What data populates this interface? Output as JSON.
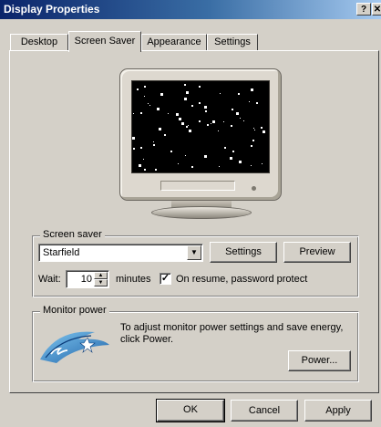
{
  "window": {
    "title": "Display Properties",
    "help_glyph": "?",
    "close_glyph": "✕"
  },
  "tabs": [
    {
      "label": "Desktop"
    },
    {
      "label": "Screen Saver"
    },
    {
      "label": "Appearance"
    },
    {
      "label": "Settings"
    }
  ],
  "screensaver": {
    "group_label": "Screen saver",
    "selected": "Starfield",
    "settings_label": "Settings",
    "preview_label": "Preview",
    "wait_label": "Wait:",
    "wait_value": "10",
    "minutes_label": "minutes",
    "checkbox_checked": true,
    "checkbox_label": "On resume, password protect"
  },
  "monitor_power": {
    "group_label": "Monitor power",
    "description": "To adjust monitor power settings and save energy, click Power.",
    "power_label": "Power..."
  },
  "dialog_buttons": {
    "ok": "OK",
    "cancel": "Cancel",
    "apply": "Apply"
  },
  "icons": {
    "dropdown_arrow": "▼",
    "spin_up": "▲",
    "spin_down": "▼",
    "checkmark": "✓"
  },
  "colors": {
    "titlebar_start": "#0a246a",
    "titlebar_end": "#a6caf0",
    "face": "#d4d0c8"
  }
}
